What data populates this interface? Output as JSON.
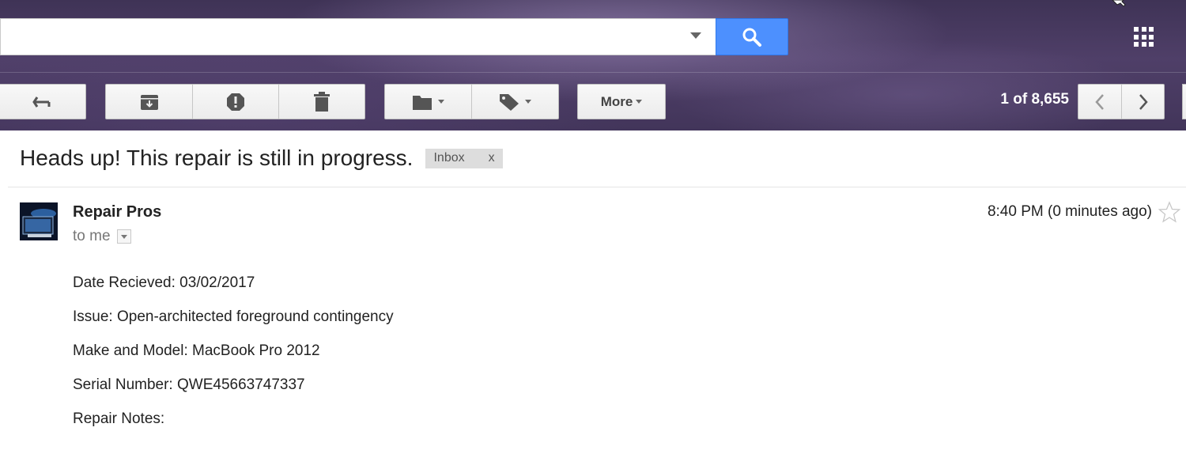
{
  "search": {
    "value": "",
    "placeholder": "",
    "search_button_icon": "search-icon",
    "apps_icon": "apps-grid-icon"
  },
  "toolbar": {
    "back_icon": "reply-back-icon",
    "archive_icon": "archive-icon",
    "spam_icon": "report-spam-icon",
    "delete_icon": "trash-icon",
    "move_icon": "folder-icon",
    "labels_icon": "label-tag-icon",
    "more_label": "More",
    "page_count": "1 of 8,655",
    "newer_icon": "chevron-left-icon",
    "older_icon": "chevron-right-icon"
  },
  "email": {
    "subject": "Heads up! This repair is still in progress.",
    "label": "Inbox",
    "label_remove": "x",
    "sender": "Repair Pros",
    "recipient": "to me",
    "timestamp": "8:40 PM (0 minutes ago)",
    "body": [
      "Date Recieved: 03/02/2017",
      "Issue: Open-architected foreground contingency",
      "Make and Model: MacBook Pro 2012",
      "Serial Number: QWE45663747337",
      "Repair Notes:"
    ]
  },
  "colors": {
    "header_bg": "#463a5e",
    "search_button": "#4d90fe",
    "label_chip": "#dddddd"
  }
}
